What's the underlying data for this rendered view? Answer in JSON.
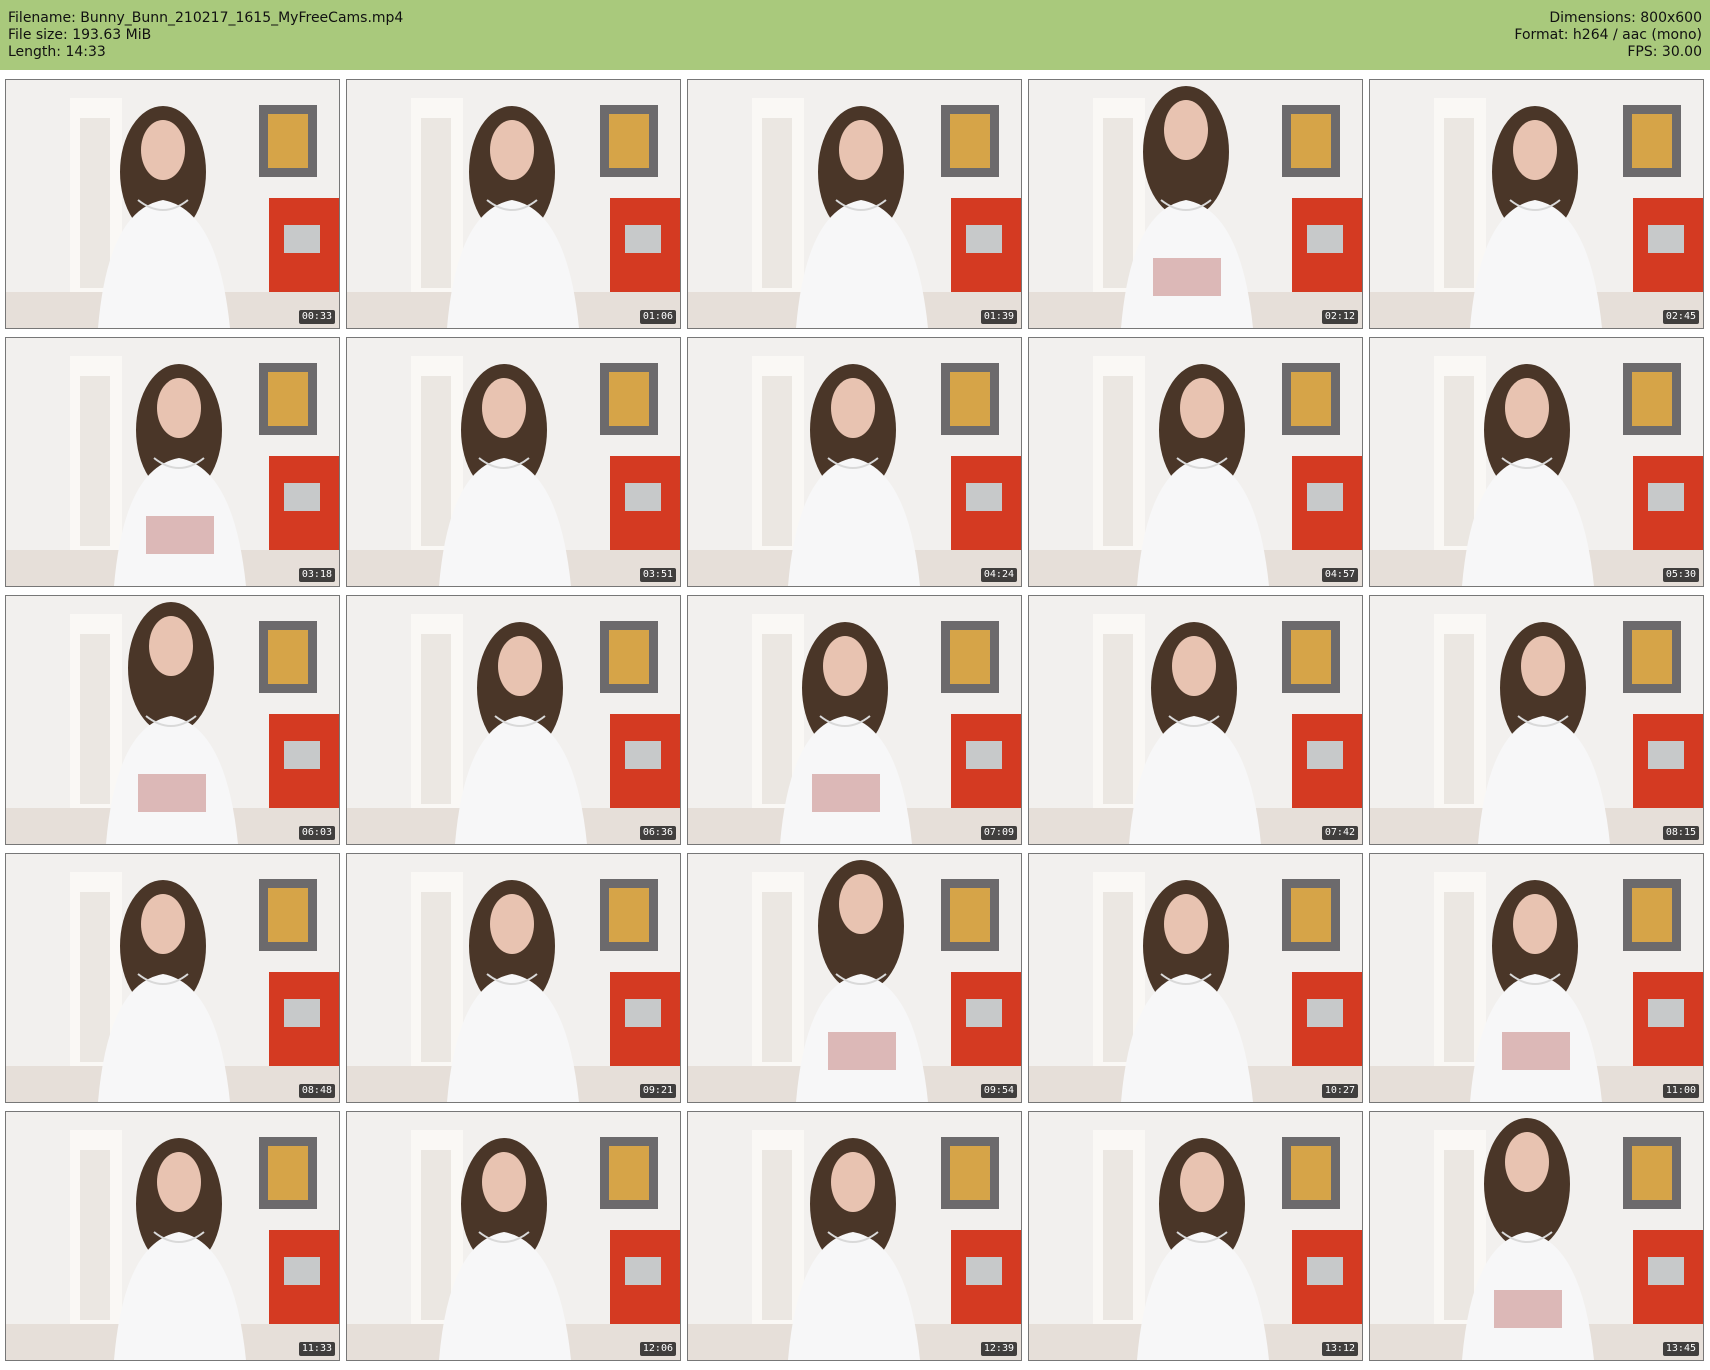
{
  "meta": {
    "filename": "Filename: Bunny_Bunn_210217_1615_MyFreeCams.mp4",
    "filesize": "File size: 193.63 MiB",
    "length": "Length: 14:33",
    "dimensions": "Dimensions: 800x600",
    "format": "Format: h264 / aac (mono)",
    "fps": "FPS: 30.00"
  },
  "colors": {
    "header": "#a9c97c",
    "wall": "#f2f0ee",
    "dresser": "#d43a22",
    "hair": "#4a3628",
    "shirt": "#f7f7f8",
    "skin": "#e8c3b1",
    "shorts": "#dcb8b7"
  },
  "frames": [
    {
      "time": "00:33"
    },
    {
      "time": "01:06"
    },
    {
      "time": "01:39"
    },
    {
      "time": "02:12"
    },
    {
      "time": "02:45"
    },
    {
      "time": "03:18"
    },
    {
      "time": "03:51"
    },
    {
      "time": "04:24"
    },
    {
      "time": "04:57"
    },
    {
      "time": "05:30"
    },
    {
      "time": "06:03"
    },
    {
      "time": "06:36"
    },
    {
      "time": "07:09"
    },
    {
      "time": "07:42"
    },
    {
      "time": "08:15"
    },
    {
      "time": "08:48"
    },
    {
      "time": "09:21"
    },
    {
      "time": "09:54"
    },
    {
      "time": "10:27"
    },
    {
      "time": "11:00"
    },
    {
      "time": "11:33"
    },
    {
      "time": "12:06"
    },
    {
      "time": "12:39"
    },
    {
      "time": "13:12"
    },
    {
      "time": "13:45"
    }
  ]
}
